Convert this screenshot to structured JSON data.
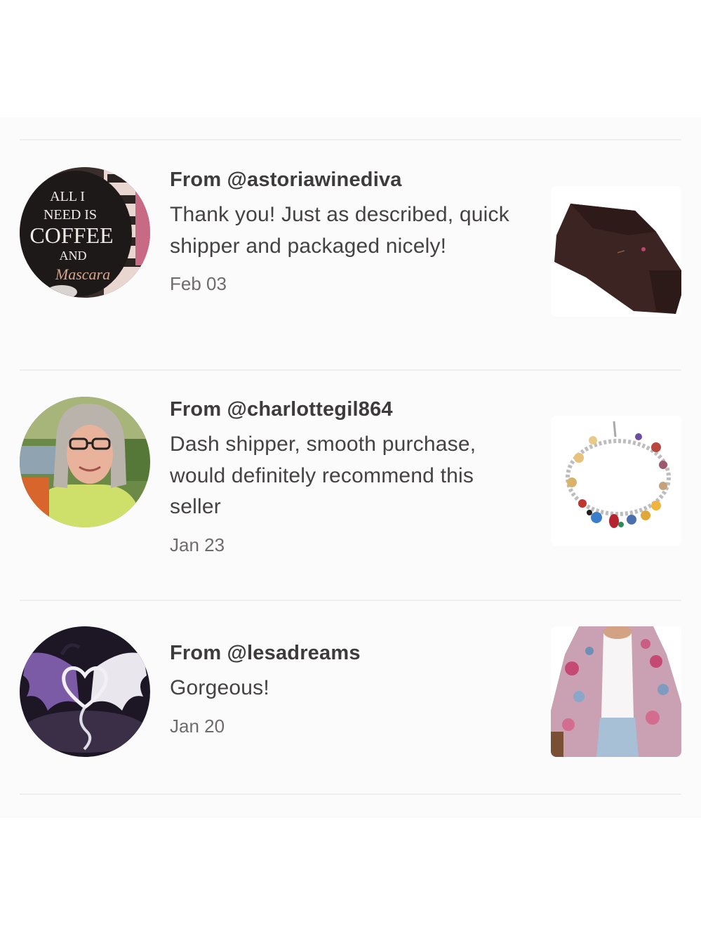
{
  "reviews": [
    {
      "from": "From @astoriawinediva",
      "comment": "Thank you! Just as described, quick shipper and packaged nicely!",
      "date": "Feb 03",
      "avatar_icon": "coffee-mug-avatar",
      "avatar_text": [
        "ALL I",
        "NEED IS",
        "COFFEE",
        "AND",
        "Mascara"
      ],
      "item_icon": "brown-scarf"
    },
    {
      "from": "From @charlottegil864",
      "comment": "Dash shipper, smooth purchase, would definitely recommend this seller",
      "date": "Jan 23",
      "avatar_icon": "woman-portrait-avatar",
      "item_icon": "charm-bracelet"
    },
    {
      "from": "From @lesadreams",
      "comment": "Gorgeous!",
      "date": "Jan 20",
      "avatar_icon": "dragon-heart-avatar",
      "item_icon": "floral-kimono"
    }
  ],
  "colors": {
    "panel_bg": "#fcfbfb",
    "divider": "#efeded",
    "username_text": "#3d3b3b",
    "comment_text": "#444242",
    "date_text": "#6e6b6b"
  }
}
